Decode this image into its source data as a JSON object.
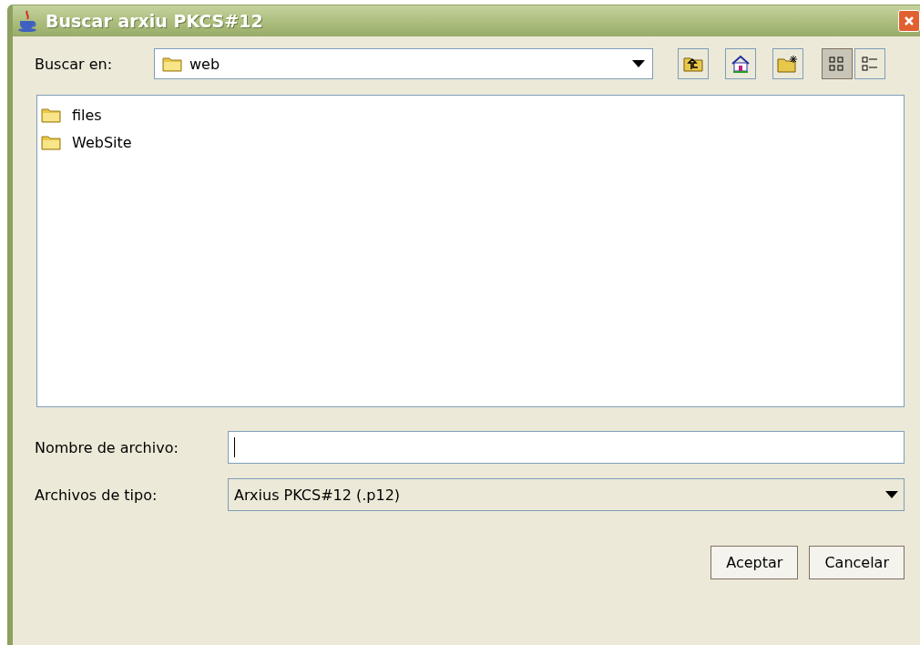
{
  "window": {
    "title": "Buscar arxiu PKCS#12"
  },
  "look_in": {
    "label": "Buscar en:",
    "value": "web"
  },
  "toolbar": [
    {
      "kind": "up"
    },
    {
      "kind": "home"
    },
    {
      "kind": "newfolder"
    },
    {
      "kind": "list",
      "selected": true
    },
    {
      "kind": "details",
      "selected": false
    }
  ],
  "files": [
    {
      "name": "files"
    },
    {
      "name": "WebSite"
    }
  ],
  "file_name": {
    "label": "Nombre de archivo:"
  },
  "file_type": {
    "label": "Archivos de tipo:",
    "value": "Arxius PKCS#12 (.p12)"
  },
  "buttons": [
    "Aceptar",
    "Cancelar"
  ]
}
